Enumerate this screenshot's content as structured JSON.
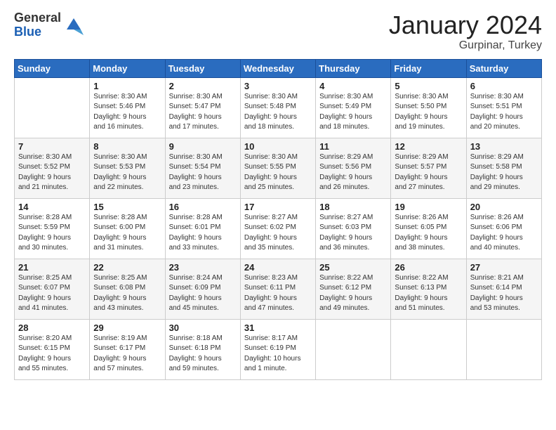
{
  "logo": {
    "general": "General",
    "blue": "Blue"
  },
  "header": {
    "title": "January 2024",
    "subtitle": "Gurpinar, Turkey"
  },
  "weekdays": [
    "Sunday",
    "Monday",
    "Tuesday",
    "Wednesday",
    "Thursday",
    "Friday",
    "Saturday"
  ],
  "weeks": [
    [
      {
        "day": null,
        "info": ""
      },
      {
        "day": "1",
        "info": "Sunrise: 8:30 AM\nSunset: 5:46 PM\nDaylight: 9 hours\nand 16 minutes."
      },
      {
        "day": "2",
        "info": "Sunrise: 8:30 AM\nSunset: 5:47 PM\nDaylight: 9 hours\nand 17 minutes."
      },
      {
        "day": "3",
        "info": "Sunrise: 8:30 AM\nSunset: 5:48 PM\nDaylight: 9 hours\nand 18 minutes."
      },
      {
        "day": "4",
        "info": "Sunrise: 8:30 AM\nSunset: 5:49 PM\nDaylight: 9 hours\nand 18 minutes."
      },
      {
        "day": "5",
        "info": "Sunrise: 8:30 AM\nSunset: 5:50 PM\nDaylight: 9 hours\nand 19 minutes."
      },
      {
        "day": "6",
        "info": "Sunrise: 8:30 AM\nSunset: 5:51 PM\nDaylight: 9 hours\nand 20 minutes."
      }
    ],
    [
      {
        "day": "7",
        "info": "Sunrise: 8:30 AM\nSunset: 5:52 PM\nDaylight: 9 hours\nand 21 minutes."
      },
      {
        "day": "8",
        "info": "Sunrise: 8:30 AM\nSunset: 5:53 PM\nDaylight: 9 hours\nand 22 minutes."
      },
      {
        "day": "9",
        "info": "Sunrise: 8:30 AM\nSunset: 5:54 PM\nDaylight: 9 hours\nand 23 minutes."
      },
      {
        "day": "10",
        "info": "Sunrise: 8:30 AM\nSunset: 5:55 PM\nDaylight: 9 hours\nand 25 minutes."
      },
      {
        "day": "11",
        "info": "Sunrise: 8:29 AM\nSunset: 5:56 PM\nDaylight: 9 hours\nand 26 minutes."
      },
      {
        "day": "12",
        "info": "Sunrise: 8:29 AM\nSunset: 5:57 PM\nDaylight: 9 hours\nand 27 minutes."
      },
      {
        "day": "13",
        "info": "Sunrise: 8:29 AM\nSunset: 5:58 PM\nDaylight: 9 hours\nand 29 minutes."
      }
    ],
    [
      {
        "day": "14",
        "info": "Sunrise: 8:28 AM\nSunset: 5:59 PM\nDaylight: 9 hours\nand 30 minutes."
      },
      {
        "day": "15",
        "info": "Sunrise: 8:28 AM\nSunset: 6:00 PM\nDaylight: 9 hours\nand 31 minutes."
      },
      {
        "day": "16",
        "info": "Sunrise: 8:28 AM\nSunset: 6:01 PM\nDaylight: 9 hours\nand 33 minutes."
      },
      {
        "day": "17",
        "info": "Sunrise: 8:27 AM\nSunset: 6:02 PM\nDaylight: 9 hours\nand 35 minutes."
      },
      {
        "day": "18",
        "info": "Sunrise: 8:27 AM\nSunset: 6:03 PM\nDaylight: 9 hours\nand 36 minutes."
      },
      {
        "day": "19",
        "info": "Sunrise: 8:26 AM\nSunset: 6:05 PM\nDaylight: 9 hours\nand 38 minutes."
      },
      {
        "day": "20",
        "info": "Sunrise: 8:26 AM\nSunset: 6:06 PM\nDaylight: 9 hours\nand 40 minutes."
      }
    ],
    [
      {
        "day": "21",
        "info": "Sunrise: 8:25 AM\nSunset: 6:07 PM\nDaylight: 9 hours\nand 41 minutes."
      },
      {
        "day": "22",
        "info": "Sunrise: 8:25 AM\nSunset: 6:08 PM\nDaylight: 9 hours\nand 43 minutes."
      },
      {
        "day": "23",
        "info": "Sunrise: 8:24 AM\nSunset: 6:09 PM\nDaylight: 9 hours\nand 45 minutes."
      },
      {
        "day": "24",
        "info": "Sunrise: 8:23 AM\nSunset: 6:11 PM\nDaylight: 9 hours\nand 47 minutes."
      },
      {
        "day": "25",
        "info": "Sunrise: 8:22 AM\nSunset: 6:12 PM\nDaylight: 9 hours\nand 49 minutes."
      },
      {
        "day": "26",
        "info": "Sunrise: 8:22 AM\nSunset: 6:13 PM\nDaylight: 9 hours\nand 51 minutes."
      },
      {
        "day": "27",
        "info": "Sunrise: 8:21 AM\nSunset: 6:14 PM\nDaylight: 9 hours\nand 53 minutes."
      }
    ],
    [
      {
        "day": "28",
        "info": "Sunrise: 8:20 AM\nSunset: 6:15 PM\nDaylight: 9 hours\nand 55 minutes."
      },
      {
        "day": "29",
        "info": "Sunrise: 8:19 AM\nSunset: 6:17 PM\nDaylight: 9 hours\nand 57 minutes."
      },
      {
        "day": "30",
        "info": "Sunrise: 8:18 AM\nSunset: 6:18 PM\nDaylight: 9 hours\nand 59 minutes."
      },
      {
        "day": "31",
        "info": "Sunrise: 8:17 AM\nSunset: 6:19 PM\nDaylight: 10 hours\nand 1 minute."
      },
      {
        "day": null,
        "info": ""
      },
      {
        "day": null,
        "info": ""
      },
      {
        "day": null,
        "info": ""
      }
    ]
  ]
}
